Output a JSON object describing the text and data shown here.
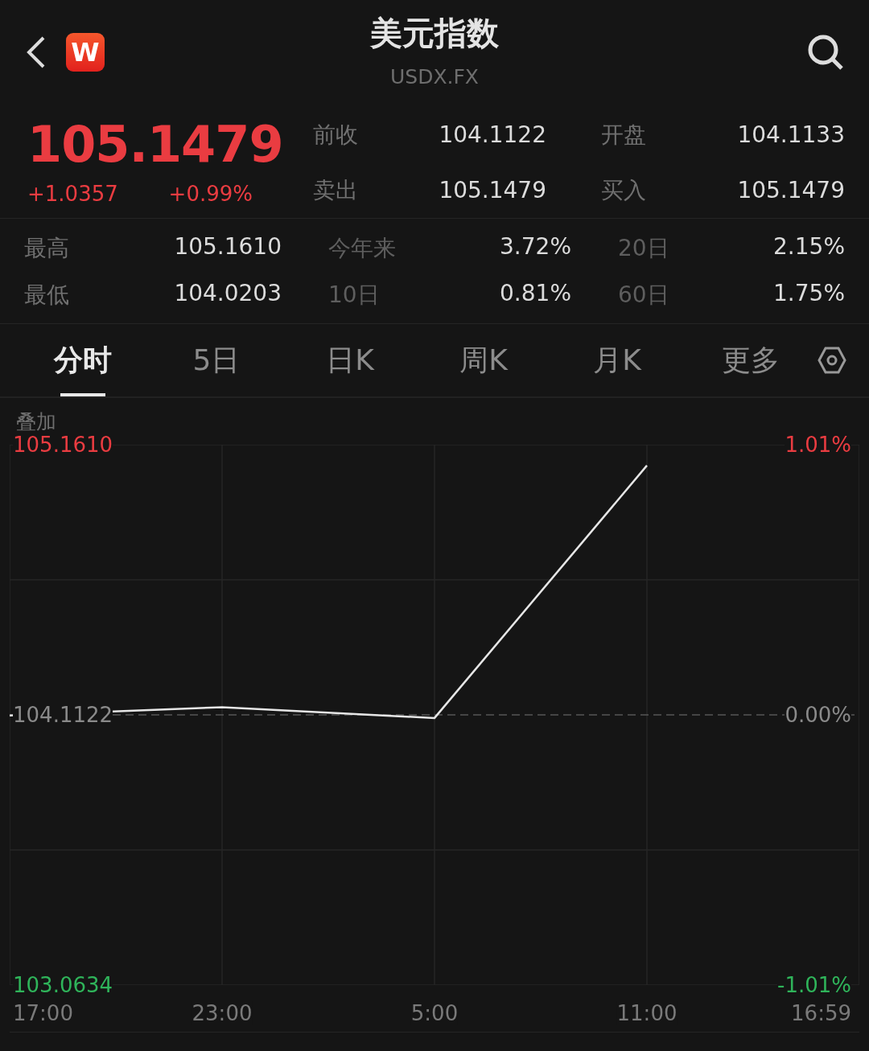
{
  "header": {
    "title": "美元指数",
    "subtitle": "USDX.FX",
    "badge": "W"
  },
  "quote": {
    "price": "105.1479",
    "change": "+1.0357",
    "change_pct": "+0.99%",
    "fields": [
      {
        "label": "前收",
        "value": "104.1122"
      },
      {
        "label": "开盘",
        "value": "104.1133"
      },
      {
        "label": "卖出",
        "value": "105.1479"
      },
      {
        "label": "买入",
        "value": "105.1479"
      }
    ]
  },
  "stats": [
    {
      "label": "最高",
      "value": "105.1610"
    },
    {
      "label": "今年来",
      "value": "3.72%"
    },
    {
      "label": "20日",
      "value": "2.15%"
    },
    {
      "label": "最低",
      "value": "104.0203"
    },
    {
      "label": "10日",
      "value": "0.81%"
    },
    {
      "label": "60日",
      "value": "1.75%"
    }
  ],
  "tabs": [
    {
      "label": "分时",
      "selected": true
    },
    {
      "label": "5日",
      "selected": false
    },
    {
      "label": "日K",
      "selected": false
    },
    {
      "label": "周K",
      "selected": false
    },
    {
      "label": "月K",
      "selected": false
    },
    {
      "label": "更多",
      "selected": false
    }
  ],
  "chart": {
    "overlay_label": "叠加",
    "levels": [
      {
        "percent": "1.01%",
        "kind": "up"
      },
      {
        "percent": "0.00%",
        "kind": "flat"
      },
      {
        "percent": "-1.01%",
        "kind": "down"
      }
    ],
    "chart_data": {
      "type": "line",
      "ylim": [
        103.0634,
        105.161
      ],
      "grid": true,
      "ref_lines": [
        {
          "axis": "y",
          "value": 104.1122
        }
      ],
      "yticks": [
        {
          "value": 105.161,
          "label": "105.1610"
        },
        {
          "value": 104.1122,
          "label": "104.1122"
        },
        {
          "value": 103.0634,
          "label": "103.0634"
        }
      ],
      "categories": [
        "17:00",
        "23:00",
        "5:00",
        "11:00",
        "16:59"
      ],
      "series": [
        {
          "color": "#e6e6e6",
          "values": [
            104.11,
            104.142,
            104.1,
            105.08,
            null
          ]
        }
      ]
    }
  }
}
